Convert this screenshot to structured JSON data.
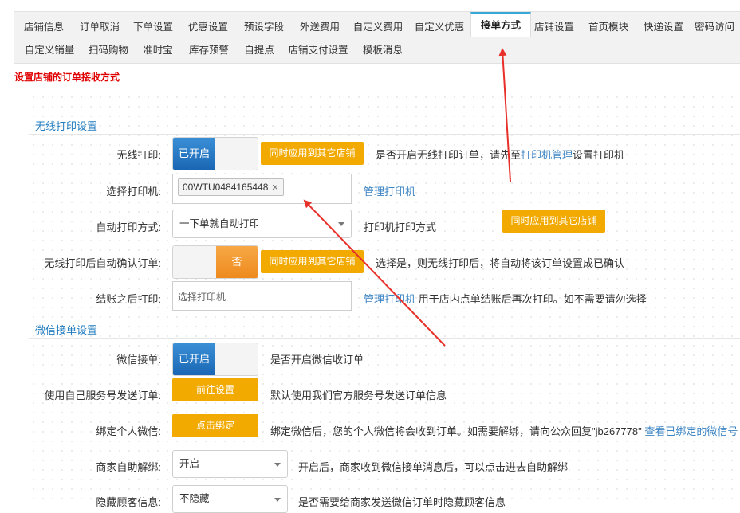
{
  "tabs_row1": [
    "店铺信息",
    "订单取消",
    "下单设置",
    "优惠设置",
    "预设字段",
    "外送费用",
    "自定义费用",
    "自定义优惠",
    "接单方式",
    "店铺设置",
    "首页模块",
    "快递设置",
    "密码访问"
  ],
  "tabs_row2": [
    "自定义销量",
    "扫码购物",
    "准时宝",
    "库存预警",
    "自提点",
    "店铺支付设置",
    "模板消息"
  ],
  "active_tab": "接单方式",
  "page_note": "设置店铺的订单接收方式",
  "wireless": {
    "section_title": "无线打印设置",
    "print_label": "无线打印:",
    "print_toggle": "已开启",
    "apply_btn": "同时应用到其它店铺",
    "print_desc_before": "是否开启无线打印订单，请先至",
    "print_desc_link": "打印机管理",
    "print_desc_after": "设置打印机",
    "select_printer_label": "选择打印机:",
    "printer_tag": "00WTU0484165448",
    "manage_printer_link": "管理打印机",
    "auto_mode_label": "自动打印方式:",
    "auto_mode_value": "一下单就自动打印",
    "auto_mode_desc": "打印机打印方式",
    "apply_btn2": "同时应用到其它店铺",
    "auto_confirm_label": "无线打印后自动确认订单:",
    "auto_confirm_toggle": "否",
    "apply_btn3": "同时应用到其它店铺",
    "auto_confirm_desc": "选择是，则无线打印后，将自动将该订单设置成已确认",
    "after_checkout_label": "结账之后打印:",
    "after_checkout_placeholder": "选择打印机",
    "after_checkout_link": "管理打印机",
    "after_checkout_desc": " 用于店内点单结账后再次打印。如不需要请勿选择"
  },
  "wechat": {
    "section_title": "微信接单设置",
    "wechat_label": "微信接单:",
    "wechat_toggle": "已开启",
    "wechat_desc": "是否开启微信收订单",
    "own_service_label": "使用自己服务号发送订单:",
    "own_service_btn": "前往设置",
    "own_service_desc": "默认使用我们官方服务号发送订单信息",
    "bind_label": "绑定个人微信:",
    "bind_btn": "点击绑定",
    "bind_desc": "绑定微信后，您的个人微信将会收到订单。如需要解绑，请向公众回复\"jb267778\" ",
    "bind_link": "查看已绑定的微信号",
    "auto_unbind_label": "商家自助解绑:",
    "auto_unbind_value": "开启",
    "auto_unbind_desc": "开启后，商家收到微信接单消息后，可以点击进去自助解绑",
    "hide_info_label": "隐藏顾客信息:",
    "hide_info_value": "不隐藏",
    "hide_info_desc": "是否需要给商家发送微信订单时隐藏顾客信息"
  },
  "colors": {
    "accent_blue": "#1f7bbf",
    "orange_btn": "#f2a900",
    "toggle_on": "#1a66b4",
    "toggle_off": "#ee8a1e",
    "arrow": "#e8302a",
    "note_red": "#e00000"
  }
}
